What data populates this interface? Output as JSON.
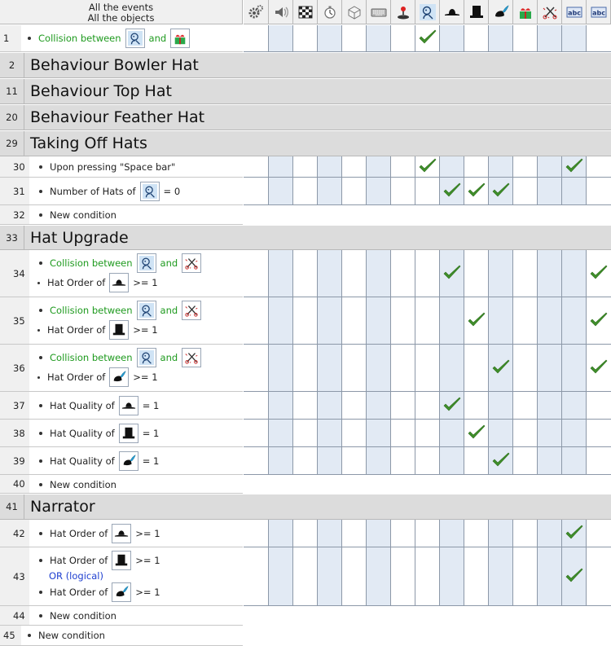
{
  "header": {
    "line1": "All the events",
    "line2": "All the objects"
  },
  "objects": [
    {
      "name": "gear-icon"
    },
    {
      "name": "speaker-icon"
    },
    {
      "name": "chessboard-icon"
    },
    {
      "name": "timer-icon"
    },
    {
      "name": "cube-icon"
    },
    {
      "name": "keyboard-icon"
    },
    {
      "name": "joystick-icon"
    },
    {
      "name": "character-icon"
    },
    {
      "name": "bowler-hat-icon"
    },
    {
      "name": "top-hat-icon"
    },
    {
      "name": "feather-hat-icon"
    },
    {
      "name": "gift-icon"
    },
    {
      "name": "scissors-icon"
    },
    {
      "name": "text-icon"
    },
    {
      "name": "text-icon-2"
    }
  ],
  "connectors": {
    "and": "and",
    "or_logical": "OR (logical)",
    "new_condition": "New condition"
  },
  "events": {
    "e1": {
      "num": "1",
      "l1_label": "Collision between"
    },
    "g2": {
      "num": "2",
      "title": "Behaviour Bowler Hat"
    },
    "g11": {
      "num": "11",
      "title": "Behaviour Top Hat"
    },
    "g20": {
      "num": "20",
      "title": "Behaviour Feather Hat"
    },
    "g29": {
      "num": "29",
      "title": "Taking Off Hats"
    },
    "e30": {
      "num": "30",
      "label": "Upon pressing \"Space bar\""
    },
    "e31": {
      "num": "31",
      "label": "Number of Hats of",
      "tail": "= 0"
    },
    "e32": {
      "num": "32"
    },
    "g33": {
      "num": "33",
      "title": "Hat Upgrade"
    },
    "e34": {
      "num": "34",
      "l1": "Collision between",
      "l2": "Hat Order of",
      "l2tail": ">= 1"
    },
    "e35": {
      "num": "35",
      "l1": "Collision between",
      "l2": "Hat Order of",
      "l2tail": ">= 1"
    },
    "e36": {
      "num": "36",
      "l1": "Collision between",
      "l2": "Hat Order of",
      "l2tail": ">= 1"
    },
    "e37": {
      "num": "37",
      "label": "Hat Quality of",
      "tail": "= 1"
    },
    "e38": {
      "num": "38",
      "label": "Hat Quality of",
      "tail": "= 1"
    },
    "e39": {
      "num": "39",
      "label": "Hat Quality of",
      "tail": "= 1"
    },
    "e40": {
      "num": "40"
    },
    "g41": {
      "num": "41",
      "title": "Narrator"
    },
    "e42": {
      "num": "42",
      "label": "Hat Order of",
      "tail": ">= 1"
    },
    "e43": {
      "num": "43",
      "l1": "Hat Order of",
      "l1tail": ">= 1",
      "l3": "Hat Order of",
      "l3tail": ">= 1"
    },
    "e44": {
      "num": "44"
    },
    "e45": {
      "num": "45"
    }
  },
  "checks": {
    "e1": [
      7
    ],
    "e30": [
      7,
      13
    ],
    "e31": [
      8,
      9,
      10
    ],
    "e32": [],
    "e34": [
      8,
      14
    ],
    "e35": [
      9,
      14
    ],
    "e36": [
      10,
      14
    ],
    "e37": [
      8
    ],
    "e38": [
      9
    ],
    "e39": [
      10
    ],
    "e40": [],
    "e42": [
      13
    ],
    "e43": [
      13
    ],
    "e44": [],
    "e45": []
  },
  "colors": {
    "check": "#3f8f2a",
    "alt_column": "#e2eaf4",
    "condition_green": "#1e9a1e",
    "or_blue": "#2040d0"
  }
}
